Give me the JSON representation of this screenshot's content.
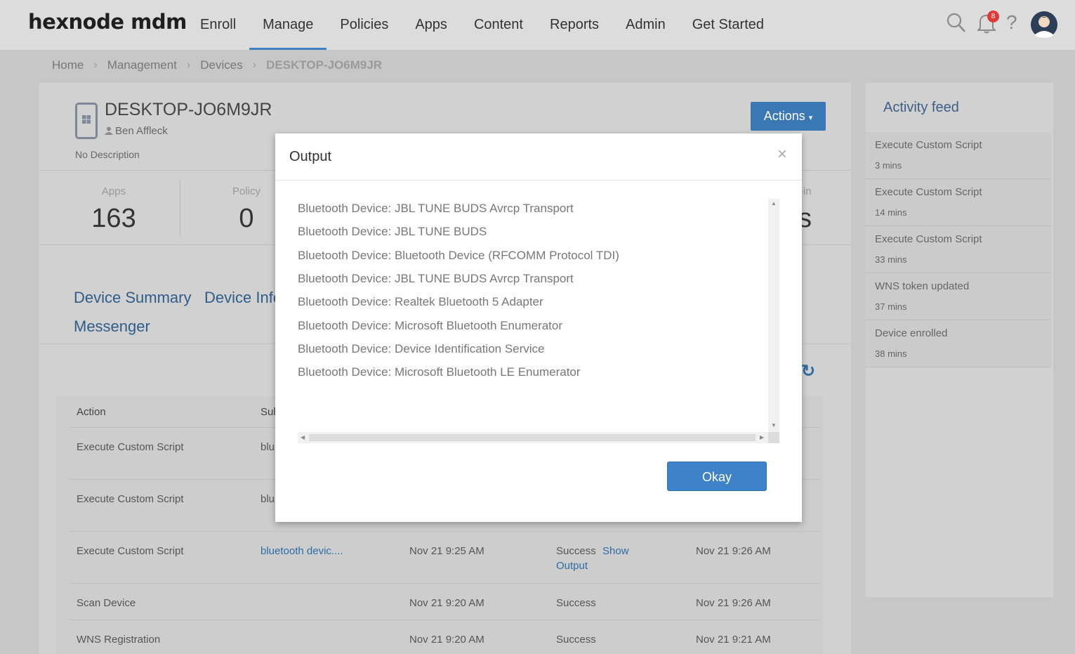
{
  "app": {
    "logo": "hexnode mdm"
  },
  "nav": {
    "items": [
      "Enroll",
      "Manage",
      "Policies",
      "Apps",
      "Content",
      "Reports",
      "Admin",
      "Get Started"
    ],
    "active": "Manage"
  },
  "topbar": {
    "notifications_count": "8",
    "help_label": "?"
  },
  "breadcrumb": [
    "Home",
    "Management",
    "Devices",
    "DESKTOP-JO6M9JR"
  ],
  "device": {
    "name": "DESKTOP-JO6M9JR",
    "user": "Ben Affleck",
    "description": "No Description",
    "actions_label": "Actions"
  },
  "stats": {
    "apps_label": "Apps",
    "apps_value": "163",
    "policy_label": "Policy",
    "policy_value": "0",
    "checkin_label_partial": "-in",
    "checkin_value_partial": "s"
  },
  "tabs": [
    "Device Summary",
    "Device Info",
    "Messenger"
  ],
  "table": {
    "headers": {
      "action": "Action",
      "subject_partial": "Sub"
    },
    "rows": [
      {
        "action": "Execute Custom Script",
        "subject": "blu"
      },
      {
        "action": "Execute Custom Script",
        "subject": "blu"
      },
      {
        "action": "Execute Custom Script",
        "subject": "bluetooth devic....",
        "started": "Nov 21 9:25 AM",
        "status": "Success",
        "link1": "Show",
        "link2": "Output",
        "completed": "Nov 21 9:26 AM"
      },
      {
        "action": "Scan Device",
        "started": "Nov 21 9:20 AM",
        "status": "Success",
        "completed": "Nov 21 9:26 AM"
      },
      {
        "action": "WNS Registration",
        "started": "Nov 21 9:20 AM",
        "status": "Success",
        "completed": "Nov 21 9:21 AM"
      }
    ]
  },
  "activity_feed": {
    "title": "Activity feed",
    "items": [
      {
        "text": "Execute Custom Script",
        "time": "3 mins"
      },
      {
        "text": "Execute Custom Script",
        "time": "14 mins"
      },
      {
        "text": "Execute Custom Script",
        "time": "33 mins"
      },
      {
        "text": "WNS token updated",
        "time": "37 mins"
      },
      {
        "text": "Device enrolled",
        "time": "38 mins"
      }
    ]
  },
  "modal": {
    "title": "Output",
    "close": "×",
    "lines": [
      "Bluetooth Device: JBL TUNE BUDS Avrcp Transport",
      "Bluetooth Device: JBL TUNE BUDS",
      "Bluetooth Device: Bluetooth Device (RFCOMM Protocol TDI)",
      "Bluetooth Device: JBL TUNE BUDS Avrcp Transport",
      "Bluetooth Device: Realtek Bluetooth 5 Adapter",
      "Bluetooth Device: Microsoft Bluetooth Enumerator",
      "Bluetooth Device: Device Identification Service",
      "Bluetooth Device: Microsoft Bluetooth LE Enumerator"
    ],
    "okay_label": "Okay"
  },
  "colors": {
    "accent": "#3e82c9",
    "badge": "#e03a3a"
  },
  "icons": [
    "search-icon",
    "bell-icon",
    "help-icon",
    "avatar",
    "windows-device-icon",
    "user-icon",
    "refresh-icon",
    "close-icon"
  ]
}
